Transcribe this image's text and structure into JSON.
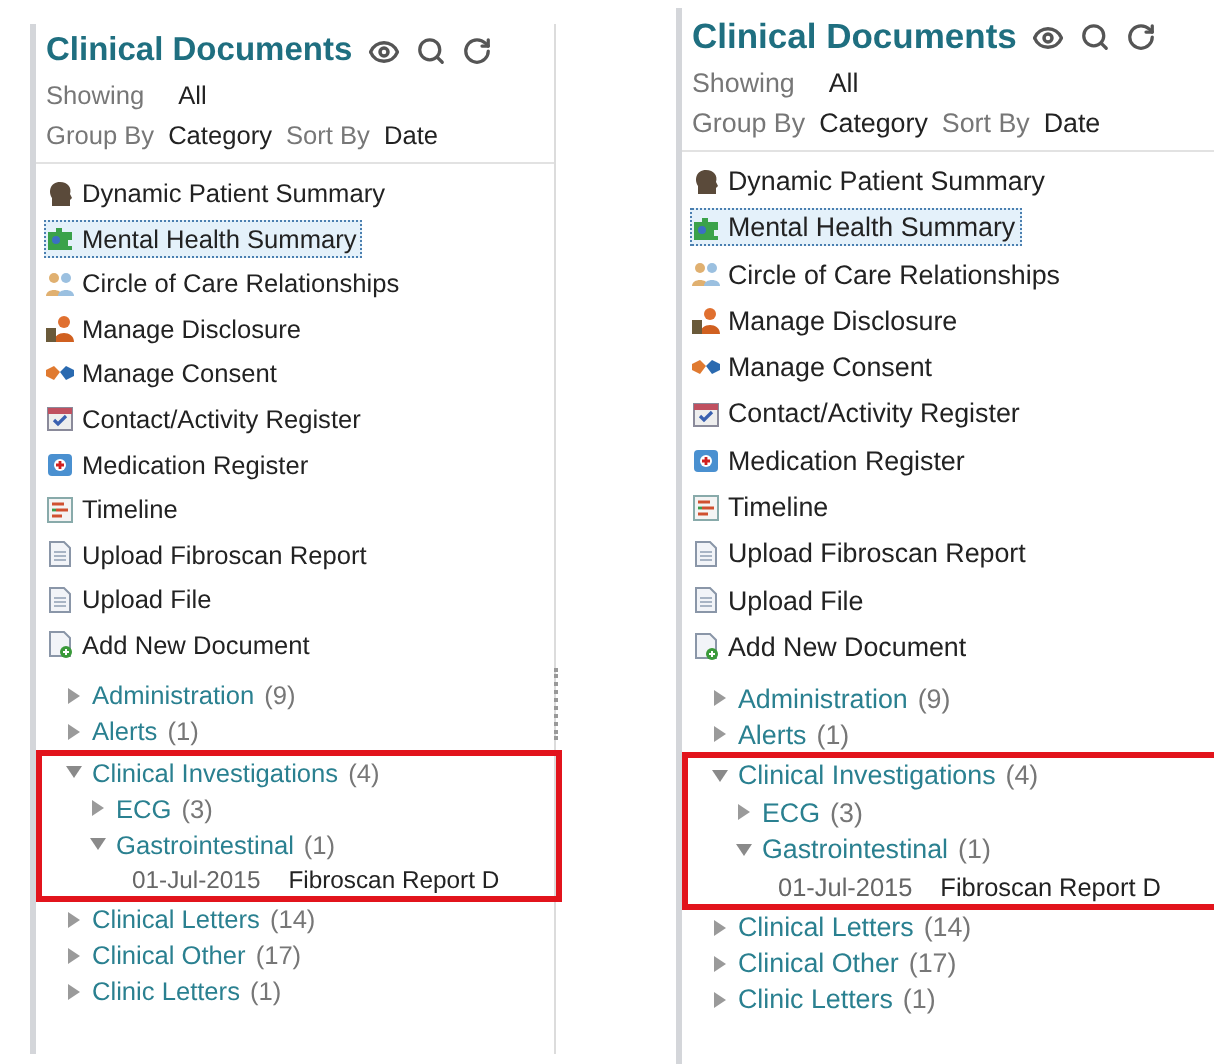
{
  "panels": [
    {
      "title": "Clinical Documents",
      "showing": {
        "label": "Showing",
        "value": "All"
      },
      "group_by": {
        "label": "Group By",
        "value": "Category"
      },
      "sort_by": {
        "label": "Sort By",
        "value": "Date"
      },
      "actions": [
        {
          "kind": "head",
          "label": "Dynamic Patient Summary",
          "selected": false
        },
        {
          "kind": "puzzle",
          "label": "Mental Health Summary",
          "selected": true
        },
        {
          "kind": "people",
          "label": "Circle of Care Relationships",
          "selected": false
        },
        {
          "kind": "disclosure",
          "label": "Manage Disclosure",
          "selected": false
        },
        {
          "kind": "handshake",
          "label": "Manage Consent",
          "selected": false
        },
        {
          "kind": "calendar",
          "label": "Contact/Activity Register",
          "selected": false
        },
        {
          "kind": "medication",
          "label": "Medication Register",
          "selected": false
        },
        {
          "kind": "timeline",
          "label": "Timeline",
          "selected": false
        },
        {
          "kind": "document",
          "label": "Upload Fibroscan Report",
          "selected": false
        },
        {
          "kind": "document",
          "label": "Upload File",
          "selected": false
        },
        {
          "kind": "add-document",
          "label": "Add New Document",
          "selected": false
        }
      ],
      "categories": [
        {
          "name": "Administration",
          "count": "(9)",
          "expanded": false,
          "highlighted": false
        },
        {
          "name": "Alerts",
          "count": "(1)",
          "expanded": false,
          "highlighted": false
        },
        {
          "name": "Clinical Investigations",
          "count": "(4)",
          "expanded": true,
          "highlighted": true,
          "children": [
            {
              "name": "ECG",
              "count": "(3)",
              "expanded": false
            },
            {
              "name": "Gastrointestinal",
              "count": "(1)",
              "expanded": true,
              "documents": [
                {
                  "date": "01-Jul-2015",
                  "title": "Fibroscan Report D"
                }
              ]
            }
          ]
        },
        {
          "name": "Clinical Letters",
          "count": "(14)",
          "expanded": false,
          "highlighted": false
        },
        {
          "name": "Clinical Other",
          "count": "(17)",
          "expanded": false,
          "highlighted": false
        },
        {
          "name": "Clinic Letters",
          "count": "(1)",
          "expanded": false,
          "highlighted": false
        }
      ]
    },
    {
      "title": "Clinical Documents",
      "showing": {
        "label": "Showing",
        "value": "All"
      },
      "group_by": {
        "label": "Group By",
        "value": "Category"
      },
      "sort_by": {
        "label": "Sort By",
        "value": "Date"
      },
      "actions": [
        {
          "kind": "head",
          "label": "Dynamic Patient Summary",
          "selected": false
        },
        {
          "kind": "puzzle",
          "label": "Mental Health Summary",
          "selected": true
        },
        {
          "kind": "people",
          "label": "Circle of Care Relationships",
          "selected": false
        },
        {
          "kind": "disclosure",
          "label": "Manage Disclosure",
          "selected": false
        },
        {
          "kind": "handshake",
          "label": "Manage Consent",
          "selected": false
        },
        {
          "kind": "calendar",
          "label": "Contact/Activity Register",
          "selected": false
        },
        {
          "kind": "medication",
          "label": "Medication Register",
          "selected": false
        },
        {
          "kind": "timeline",
          "label": "Timeline",
          "selected": false
        },
        {
          "kind": "document",
          "label": "Upload Fibroscan Report",
          "selected": false
        },
        {
          "kind": "document",
          "label": "Upload File",
          "selected": false
        },
        {
          "kind": "add-document",
          "label": "Add New Document",
          "selected": false
        }
      ],
      "categories": [
        {
          "name": "Administration",
          "count": "(9)",
          "expanded": false,
          "highlighted": false
        },
        {
          "name": "Alerts",
          "count": "(1)",
          "expanded": false,
          "highlighted": false
        },
        {
          "name": "Clinical Investigations",
          "count": "(4)",
          "expanded": true,
          "highlighted": true,
          "children": [
            {
              "name": "ECG",
              "count": "(3)",
              "expanded": false
            },
            {
              "name": "Gastrointestinal",
              "count": "(1)",
              "expanded": true,
              "documents": [
                {
                  "date": "01-Jul-2015",
                  "title": "Fibroscan Report D"
                }
              ]
            }
          ]
        },
        {
          "name": "Clinical Letters",
          "count": "(14)",
          "expanded": false,
          "highlighted": false
        },
        {
          "name": "Clinical Other",
          "count": "(17)",
          "expanded": false,
          "highlighted": false
        },
        {
          "name": "Clinic Letters",
          "count": "(1)",
          "expanded": false,
          "highlighted": false
        }
      ]
    }
  ]
}
